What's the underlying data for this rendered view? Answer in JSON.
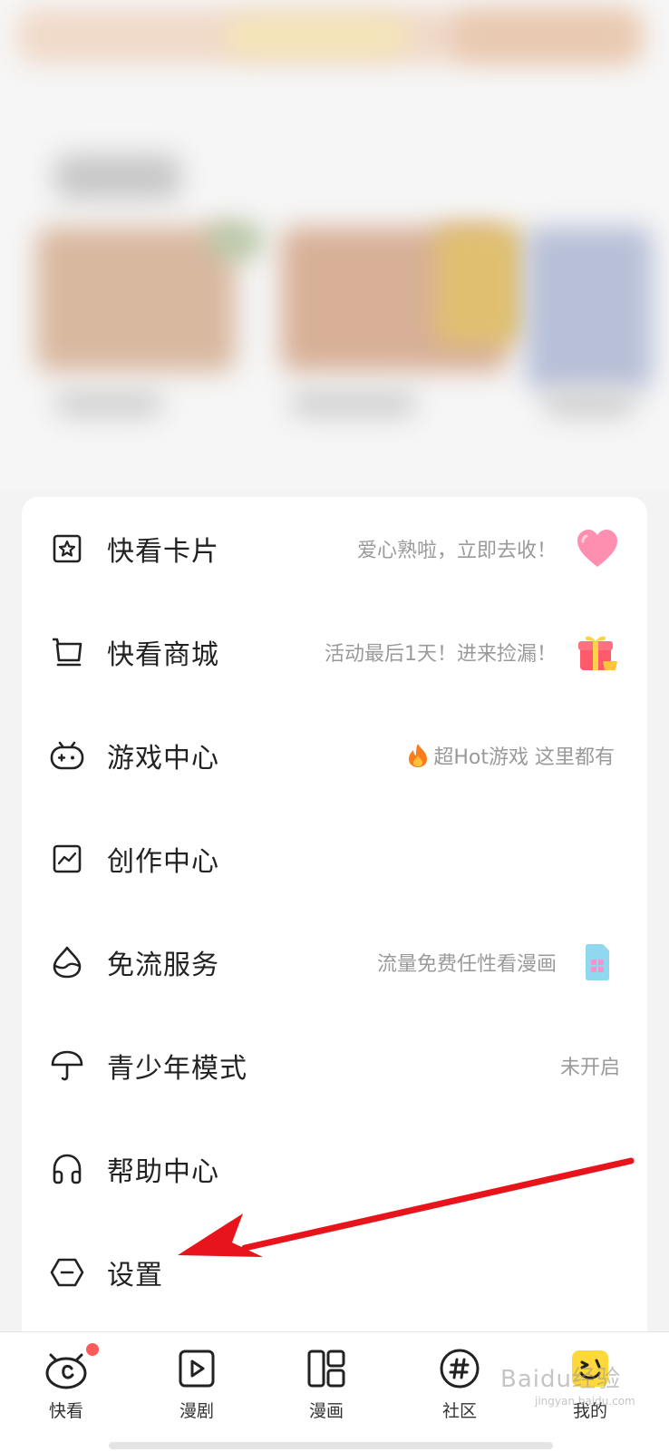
{
  "menu": {
    "items": [
      {
        "label": "快看卡片",
        "hint": "爱心熟啦，立即去收！",
        "icon": "card-star-icon",
        "badge": "heart-icon"
      },
      {
        "label": "快看商城",
        "hint": "活动最后1天！进来捡漏！",
        "icon": "cart-icon",
        "badge": "gift-icon"
      },
      {
        "label": "游戏中心",
        "hint": "超Hot游戏 这里都有",
        "icon": "gamepad-icon",
        "badge": "fire-icon"
      },
      {
        "label": "创作中心",
        "hint": "",
        "icon": "chart-icon"
      },
      {
        "label": "免流服务",
        "hint": "流量免费任性看漫画",
        "icon": "water-drop-icon",
        "badge": "sim-card-icon"
      },
      {
        "label": "青少年模式",
        "hint": "未开启",
        "icon": "umbrella-icon"
      },
      {
        "label": "帮助中心",
        "hint": "",
        "icon": "headphones-icon"
      },
      {
        "label": "设置",
        "hint": "",
        "icon": "settings-hexagon-icon"
      }
    ]
  },
  "bottom_nav": {
    "tabs": [
      {
        "label": "快看",
        "icon": "kuaikan-icon"
      },
      {
        "label": "漫剧",
        "icon": "play-icon"
      },
      {
        "label": "漫画",
        "icon": "comic-grid-icon"
      },
      {
        "label": "社区",
        "icon": "hashtag-icon"
      },
      {
        "label": "我的",
        "icon": "profile-face-icon"
      }
    ]
  },
  "watermark": {
    "text": "Baidu经验",
    "sub": "jingyan.baidu.com"
  },
  "colors": {
    "accent_red": "#e8141b",
    "badge_dot": "#ff5b5b",
    "profile_yellow": "#ffd83a"
  }
}
